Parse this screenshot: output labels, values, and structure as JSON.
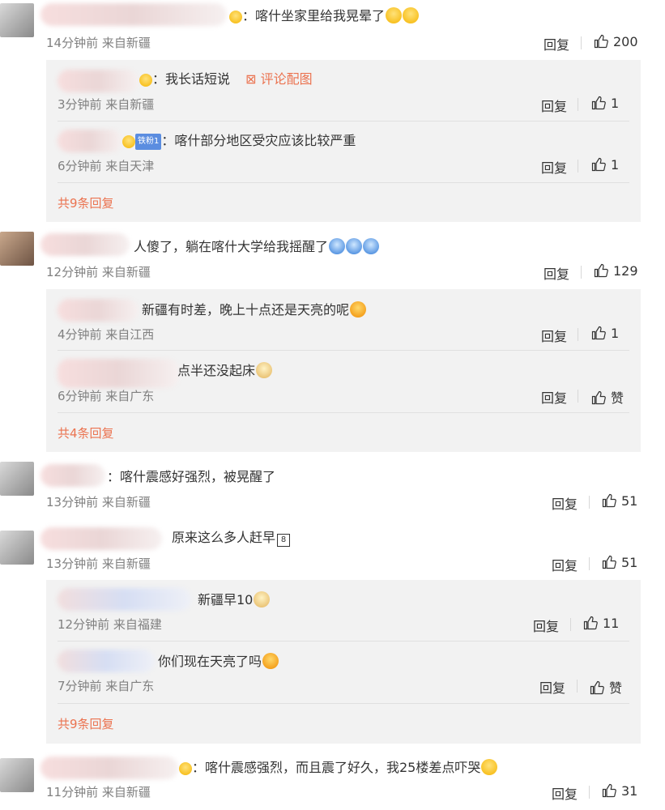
{
  "labels": {
    "reply": "回复"
  },
  "comments": [
    {
      "text": "：喀什坐家里给我晃晕了",
      "meta": "14分钟前 来自新疆",
      "likes": "200",
      "replies": [
        {
          "text": "：我长话短说",
          "extra": "评论配图",
          "meta": "3分钟前 来自新疆",
          "likes": "1"
        },
        {
          "badge": "铁粉1",
          "text": "：喀什部分地区受灾应该比较严重",
          "meta": "6分钟前 来自天津",
          "likes": "1"
        }
      ],
      "more": "共9条回复"
    },
    {
      "text": "人傻了，躺在喀什大学给我摇醒了",
      "meta": "12分钟前 来自新疆",
      "likes": "129",
      "replies": [
        {
          "text": "新疆有时差，晚上十点还是天亮的呢",
          "meta": "4分钟前 来自江西",
          "likes": "1"
        },
        {
          "text": "点半还没起床",
          "meta": "6分钟前 来自广东",
          "likes": "赞"
        }
      ],
      "more": "共4条回复"
    },
    {
      "text": "：喀什震感好强烈，被晃醒了",
      "meta": "13分钟前 来自新疆",
      "likes": "51"
    },
    {
      "text": "原来这么多人赶早",
      "meta": "13分钟前 来自新疆",
      "likes": "51",
      "replies": [
        {
          "text": "新疆早10",
          "meta": "12分钟前 来自福建",
          "likes": "11"
        },
        {
          "text": "你们现在天亮了吗",
          "meta": "7分钟前 来自广东",
          "likes": "赞"
        }
      ],
      "more": "共9条回复"
    },
    {
      "text": "：喀什震感强烈，而且震了好久，我25楼差点吓哭",
      "meta": "11分钟前 来自新疆",
      "likes": "31"
    }
  ]
}
